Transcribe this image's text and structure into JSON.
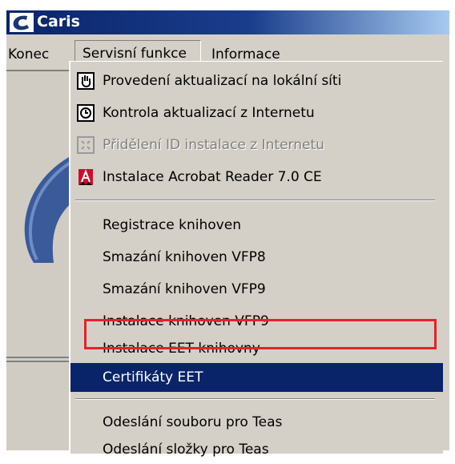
{
  "window": {
    "title": "Caris"
  },
  "menubar": {
    "items": [
      "Konec",
      "Servisní funkce",
      "Informace"
    ]
  },
  "dropdown": {
    "items": [
      {
        "label": "Provedení aktualizací na lokální síti",
        "icon": "network-update-icon",
        "state": "normal"
      },
      {
        "label": "Kontrola aktualizací z Internetu",
        "icon": "internet-check-icon",
        "state": "normal"
      },
      {
        "label": "Přidělení ID instalace z Internetu",
        "icon": "id-assign-icon",
        "state": "disabled"
      },
      {
        "label": "Instalace Acrobat Reader 7.0 CE",
        "icon": "acrobat-icon",
        "state": "normal"
      },
      {
        "label": "Registrace knihoven",
        "state": "normal"
      },
      {
        "label": "Smazání knihoven VFP8",
        "state": "normal"
      },
      {
        "label": "Smazání knihoven VFP9",
        "state": "normal"
      },
      {
        "label": "Instalace knihoven VFP9",
        "state": "normal"
      },
      {
        "label": "Instalace EET knihovny",
        "state": "annotated"
      },
      {
        "label": "Certifikáty EET",
        "state": "highlighted"
      },
      {
        "label": "Odeslání souboru pro Teas",
        "state": "normal"
      },
      {
        "label": "Odeslání složky pro Teas",
        "state": "partially-visible"
      }
    ]
  },
  "colors": {
    "titlebar": "#0a246a",
    "menu_bg": "#d4d0c8",
    "highlight": "#0a246a",
    "annotation": "#e8202a"
  }
}
